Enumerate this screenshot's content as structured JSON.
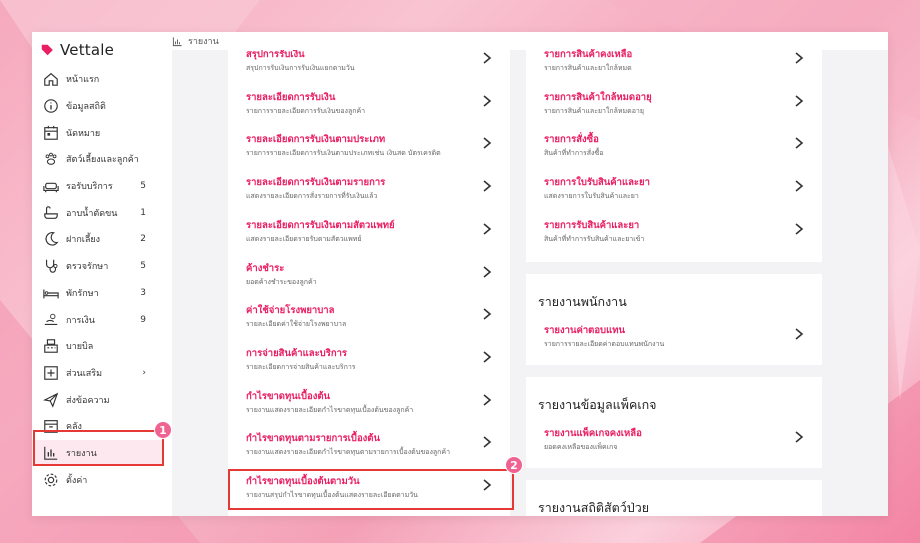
{
  "app": {
    "name": "Vettale"
  },
  "breadcrumb": {
    "label": "รายงาน"
  },
  "sidebar": {
    "items": [
      {
        "label": "หน้าแรก",
        "icon": "home-icon",
        "count": ""
      },
      {
        "label": "ข้อมูลสถิติ",
        "icon": "info-icon",
        "count": ""
      },
      {
        "label": "นัดหมาย",
        "icon": "calendar-icon",
        "count": ""
      },
      {
        "label": "สัตว์เลี้ยงและลูกค้า",
        "icon": "paw-icon",
        "count": ""
      },
      {
        "label": "รอรับบริการ",
        "icon": "sofa-icon",
        "count": "5"
      },
      {
        "label": "อาบน้ำตัดขน",
        "icon": "bath-icon",
        "count": "1"
      },
      {
        "label": "ฝากเลี้ยง",
        "icon": "moon-icon",
        "count": "2"
      },
      {
        "label": "ตรวจรักษา",
        "icon": "stethoscope-icon",
        "count": "5"
      },
      {
        "label": "พักรักษา",
        "icon": "bed-icon",
        "count": "3"
      },
      {
        "label": "การเงิน",
        "icon": "money-icon",
        "count": "9"
      },
      {
        "label": "บายบิล",
        "icon": "register-icon",
        "count": ""
      },
      {
        "label": "ส่วนเสริม",
        "icon": "plus-square-icon",
        "count": "›"
      },
      {
        "label": "ส่งข้อความ",
        "icon": "send-icon",
        "count": ""
      },
      {
        "label": "คลัง",
        "icon": "inventory-icon",
        "count": ""
      },
      {
        "label": "รายงาน",
        "icon": "report-chart-icon",
        "count": ""
      },
      {
        "label": "ตั้งค่า",
        "icon": "gear-icon",
        "count": ""
      }
    ]
  },
  "badges": {
    "one": "1",
    "two": "2"
  },
  "left_reports": [
    {
      "title": "สรุปการรับเงิน",
      "desc": "สรุปการรับเงินการรับเงินแยกตามวัน"
    },
    {
      "title": "รายละเอียดการรับเงิน",
      "desc": "รายการรายละเอียดการรับเงินของลูกค้า"
    },
    {
      "title": "รายละเอียดการรับเงินตามประเภท",
      "desc": "รายการรายละเอียดการรับเงินตามประเภทเช่น เงินสด บัตรเครดิต"
    },
    {
      "title": "รายละเอียดการรับเงินตามรายการ",
      "desc": "แสดงรายละเอียดการสั่งรายการที่รับเงินแล้ว"
    },
    {
      "title": "รายละเอียดการรับเงินตามสัตวแพทย์",
      "desc": "แสดงรายละเอียดรายรับตามสัตวแพทย์"
    },
    {
      "title": "ค้างชำระ",
      "desc": "ยอดค้างชำระของลูกค้า"
    },
    {
      "title": "ค่าใช้จ่ายโรงพยาบาล",
      "desc": "รายละเอียดค่าใช้จ่ายโรงพยาบาล"
    },
    {
      "title": "การจ่ายสินค้าและบริการ",
      "desc": "รายละเอียดการจ่ายสินค้าและบริการ"
    },
    {
      "title": "กำไรขาดทุนเบื้องต้น",
      "desc": "รายงานแสดงรายละเอียดกำไรขาดทุนเบื้องต้นของลูกค้า"
    },
    {
      "title": "กำไรขาดทุนตามรายการเบื้องต้น",
      "desc": "รายงานแสดงรายละเอียดกำไรขาดทุนตามรายการเบื้องต้นของลูกค้า"
    },
    {
      "title": "กำไรขาดทุนเบื้องต้นตามวัน",
      "desc": "รายงานสรุปกำไรขาดทุนเบื้องต้นแสดงรายละเอียดตามวัน"
    }
  ],
  "right_top_reports": [
    {
      "title": "รายการสินค้าคงเหลือ",
      "desc": "รายการสินค้าและยาใกล้หมด"
    },
    {
      "title": "รายการสินค้าใกล้หมดอายุ",
      "desc": "รายการสินค้าและยาใกล้หมดอายุ"
    },
    {
      "title": "รายการสั่งซื้อ",
      "desc": "สินค้าที่ทำการสั่งซื้อ"
    },
    {
      "title": "รายการใบรับสินค้าและยา",
      "desc": "แสดงรายการใบรับสินค้าและยา"
    },
    {
      "title": "รายการรับสินค้าและยา",
      "desc": "สินค้าที่ทำการรับสินค้าและยาเข้า"
    }
  ],
  "staff_section": {
    "title": "รายงานพนักงาน",
    "reports": [
      {
        "title": "รายงานค่าตอบแทน",
        "desc": "รายการรายละเอียดค่าตอบแทนพนักงาน"
      }
    ]
  },
  "package_section": {
    "title": "รายงานข้อมูลแพ็คเกจ",
    "reports": [
      {
        "title": "รายงานแพ็คเกจคงเหลือ",
        "desc": "ยอดคงเหลือของแพ็คเกจ"
      }
    ]
  },
  "sick_section": {
    "title": "รายงานสถิติสัตว์ป่วย"
  },
  "colors": {
    "accent": "#e91e63",
    "highlight": "#e53935",
    "badge": "#f06292",
    "active_bg": "#fde8ef"
  }
}
